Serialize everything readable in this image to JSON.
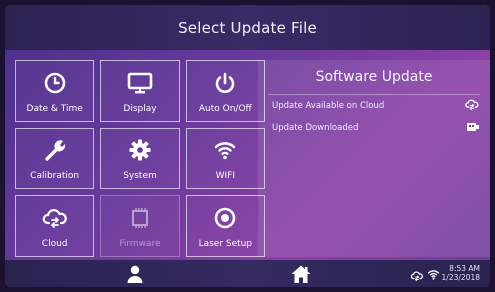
{
  "header": {
    "title": "Select Update File"
  },
  "tiles": [
    {
      "label": "Date & Time",
      "icon": "clock-icon"
    },
    {
      "label": "Display",
      "icon": "monitor-icon"
    },
    {
      "label": "Auto On/Off",
      "icon": "power-icon"
    },
    {
      "label": "Calibration",
      "icon": "wrench-icon"
    },
    {
      "label": "System",
      "icon": "gear-icon"
    },
    {
      "label": "WIFI",
      "icon": "wifi-icon"
    },
    {
      "label": "Cloud",
      "icon": "cloud-sync-icon"
    },
    {
      "label": "Firmware",
      "icon": "chip-icon",
      "disabled": true
    },
    {
      "label": "Laser Setup",
      "icon": "target-icon"
    }
  ],
  "panel": {
    "title": "Software Update",
    "items": [
      {
        "label": "Update Available on Cloud",
        "icon": "cloud-sync-icon"
      },
      {
        "label": "Update Downloaded",
        "icon": "usb-drive-icon"
      }
    ]
  },
  "footer": {
    "user_icon": "user-icon",
    "home_icon": "home-icon",
    "cloud_icon": "cloud-sync-icon",
    "wifi_icon": "wifi-icon",
    "time": "8:53 AM",
    "date": "1/23/2018"
  },
  "colors": {
    "header_bg": "#2b2352",
    "background_start": "#4a2f8a",
    "background_end": "#8b3fa6",
    "tile_border": "#ffffff"
  }
}
